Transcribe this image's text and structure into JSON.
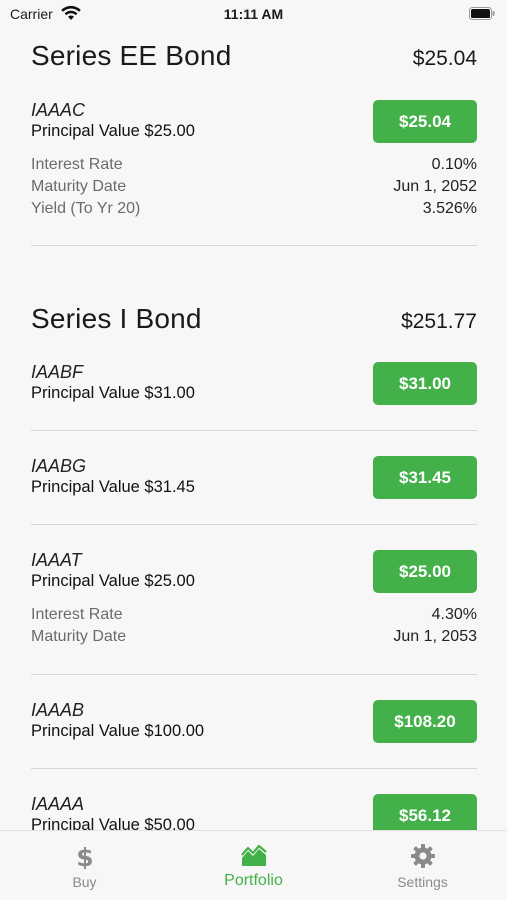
{
  "status_bar": {
    "carrier": "Carrier",
    "time": "11:11 AM"
  },
  "sections": [
    {
      "title": "Series EE Bond",
      "total": "$25.04",
      "bonds": [
        {
          "id": "IAAAC",
          "principal": "Principal Value $25.00",
          "value": "$25.04",
          "details": [
            {
              "label": "Interest Rate",
              "value": "0.10%"
            },
            {
              "label": "Maturity Date",
              "value": "Jun 1, 2052"
            },
            {
              "label": "Yield (To Yr 20)",
              "value": "3.526%"
            }
          ]
        }
      ]
    },
    {
      "title": "Series I Bond",
      "total": "$251.77",
      "bonds": [
        {
          "id": "IAABF",
          "principal": "Principal Value $31.00",
          "value": "$31.00"
        },
        {
          "id": "IAABG",
          "principal": "Principal Value $31.45",
          "value": "$31.45"
        },
        {
          "id": "IAAAT",
          "principal": "Principal Value $25.00",
          "value": "$25.00",
          "details": [
            {
              "label": "Interest Rate",
              "value": "4.30%"
            },
            {
              "label": "Maturity Date",
              "value": "Jun 1, 2053"
            }
          ]
        },
        {
          "id": "IAAAB",
          "principal": "Principal Value $100.00",
          "value": "$108.20"
        },
        {
          "id": "IAAAA",
          "principal": "Principal Value $50.00",
          "value": "$56.12"
        }
      ]
    }
  ],
  "tabs": [
    {
      "label": "Buy",
      "icon": "dollar-icon",
      "active": false
    },
    {
      "label": "Portfolio",
      "icon": "chart-icon",
      "active": true
    },
    {
      "label": "Settings",
      "icon": "gear-icon",
      "active": false
    }
  ],
  "colors": {
    "accent": "#43b049",
    "inactive": "#8a8a8a",
    "background": "#f7f7f7"
  }
}
